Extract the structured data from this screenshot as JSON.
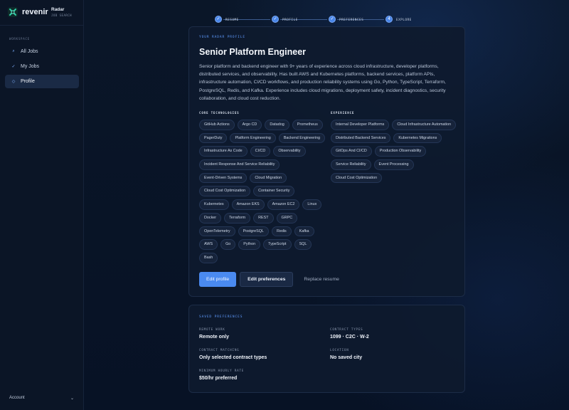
{
  "brand": {
    "name": "revenir",
    "workspace_title": "Radar",
    "workspace_subtitle": "JOB SEARCH"
  },
  "sidebar": {
    "section_label": "WORKSPACE",
    "items": [
      {
        "label": "All Jobs",
        "icon": "search-icon",
        "glyph": "⌕",
        "active": false
      },
      {
        "label": "My Jobs",
        "icon": "check-icon",
        "glyph": "✓",
        "active": false
      },
      {
        "label": "Profile",
        "icon": "profile-icon",
        "glyph": "◇",
        "active": true
      }
    ],
    "account_label": "Account",
    "account_glyph": "⌄"
  },
  "stepper": {
    "steps": [
      {
        "label": "RESUME",
        "glyph": "✓"
      },
      {
        "label": "PROFILE",
        "glyph": "✓"
      },
      {
        "label": "PREFERENCES",
        "glyph": "✓"
      },
      {
        "label": "EXPLORE",
        "glyph": "4"
      }
    ]
  },
  "profile": {
    "eyebrow": "YOUR RADAR PROFILE",
    "title": "Senior Platform Engineer",
    "summary": "Senior platform and backend engineer with 9+ years of experience across cloud infrastructure, developer platforms, distributed services, and observability. Has built AWS and Kubernetes platforms, backend services, platform APIs, infrastructure automation, CI/CD workflows, and production reliability systems using Go, Python, TypeScript, Terraform, PostgreSQL, Redis, and Kafka. Experience includes cloud migrations, deployment safety, incident diagnostics, security collaboration, and cloud cost reduction.",
    "core_label": "CORE TECHNOLOGIES",
    "core_technologies": [
      "GitHub Actions",
      "Argo CD",
      "Datadog",
      "Prometheus",
      "PagerDuty",
      "Platform Engineering",
      "Backend Engineering",
      "Infrastructure As Code",
      "CI/CD",
      "Observability",
      "Incident Response And Service Reliability",
      "Event-Driven Systems",
      "Cloud Migration",
      "Cloud Cost Optimization",
      "Container Security",
      "Kubernetes",
      "Amazon EKS",
      "Amazon EC2",
      "Linux",
      "Docker",
      "Terraform",
      "REST",
      "GRPC",
      "OpenTelemetry",
      "PostgreSQL",
      "Redis",
      "Kafka",
      "AWS",
      "Go",
      "Python",
      "TypeScript",
      "SQL",
      "Bash"
    ],
    "experience_label": "EXPERIENCE",
    "experience": [
      "Internal Developer Platforms",
      "Cloud Infrastructure Automation",
      "Distributed Backend Services",
      "Kubernetes Migrations",
      "GitOps And CI/CD",
      "Production Observability",
      "Service Reliability",
      "Event Processing",
      "Cloud Cost Optimization"
    ],
    "buttons": {
      "edit_profile": "Edit profile",
      "edit_preferences": "Edit preferences",
      "replace_resume": "Replace resume"
    }
  },
  "preferences": {
    "eyebrow": "SAVED PREFERENCES",
    "remote_work_label": "REMOTE WORK",
    "remote_work_value": "Remote only",
    "contract_types_label": "CONTRACT TYPES",
    "contract_types_value": "1099 · C2C · W-2",
    "contract_matching_label": "CONTRACT MATCHING",
    "contract_matching_value": "Only selected contract types",
    "location_label": "LOCATION",
    "location_value": "No saved city",
    "min_rate_label": "MINIMUM HOURLY RATE",
    "min_rate_value": "$50/hr preferred"
  },
  "colors": {
    "accent": "#4a8af0",
    "background": "#07101f",
    "card": "#0e1a2e"
  }
}
